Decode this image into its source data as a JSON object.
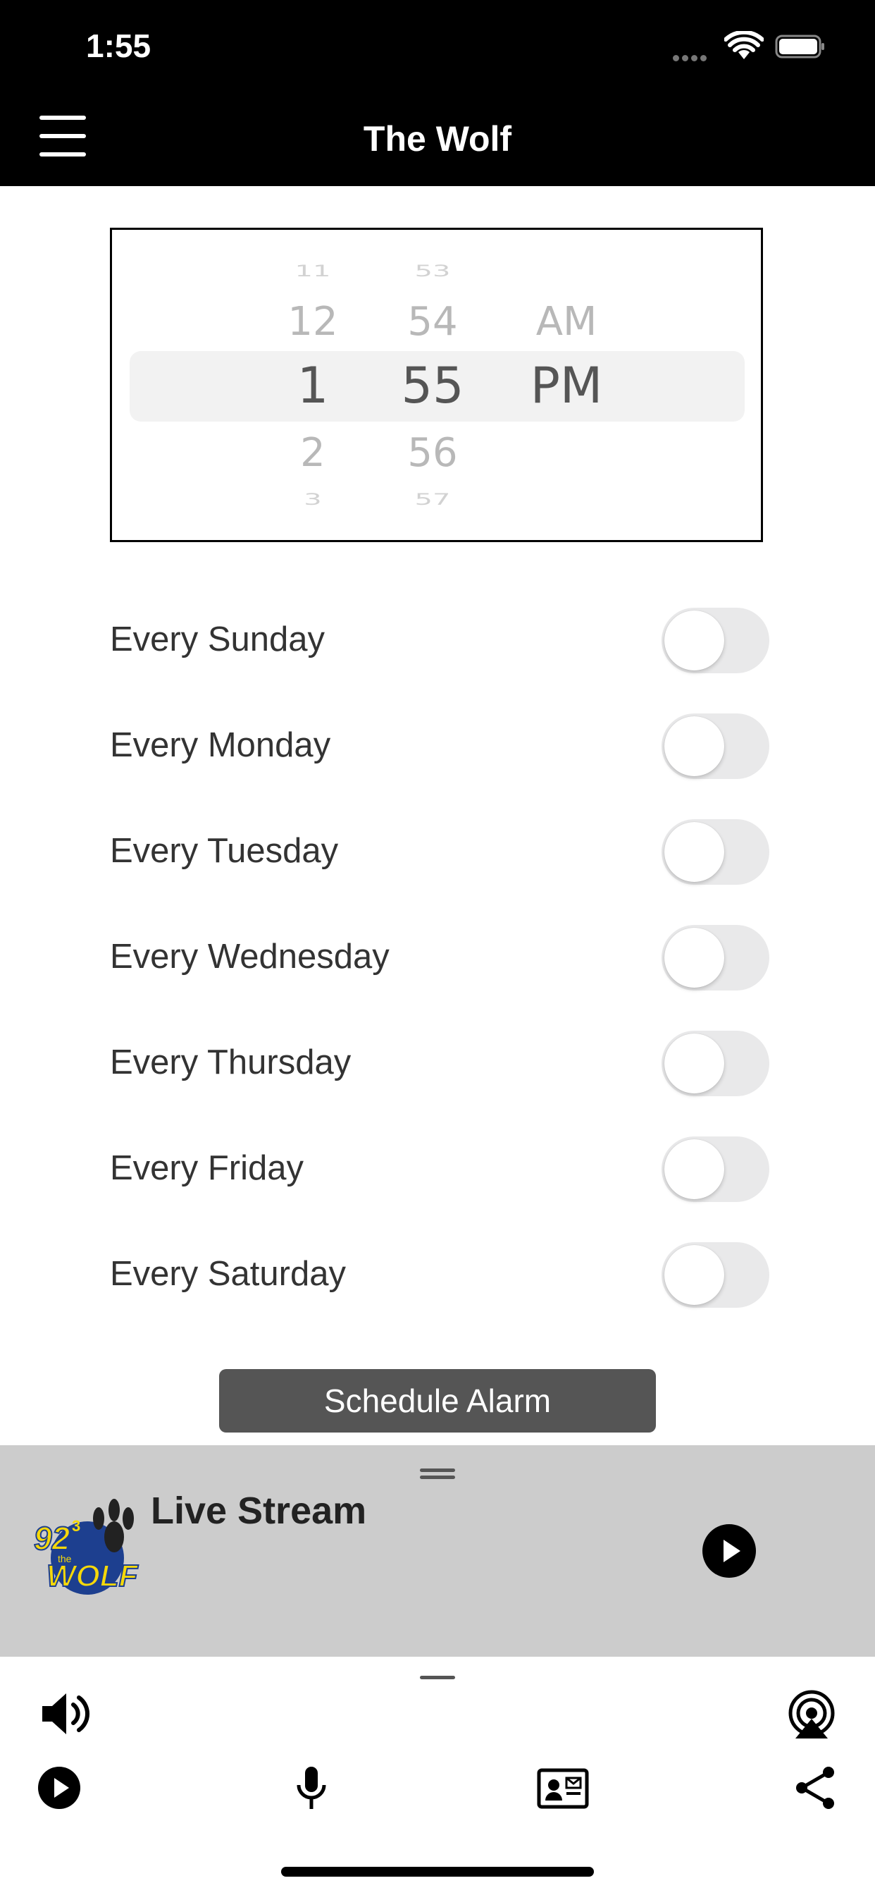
{
  "status_bar": {
    "time": "1:55"
  },
  "nav": {
    "title": "The Wolf",
    "menu_icon": "hamburger-menu-icon"
  },
  "picker": {
    "hours": [
      "11",
      "12",
      "1",
      "2",
      "3"
    ],
    "minutes": [
      "53",
      "54",
      "55",
      "56",
      "57"
    ],
    "periods": [
      "AM",
      "PM"
    ],
    "selected": {
      "hour": "1",
      "minute": "55",
      "period": "PM"
    }
  },
  "days": [
    {
      "label": "Every Sunday",
      "on": false
    },
    {
      "label": "Every Monday",
      "on": false
    },
    {
      "label": "Every Tuesday",
      "on": false
    },
    {
      "label": "Every Wednesday",
      "on": false
    },
    {
      "label": "Every Thursday",
      "on": false
    },
    {
      "label": "Every Friday",
      "on": false
    },
    {
      "label": "Every Saturday",
      "on": false
    }
  ],
  "schedule_button": "Schedule Alarm",
  "player": {
    "title": "Live Stream",
    "logo_text": {
      "number": "92",
      "sup": "3",
      "the": "the",
      "name": "WOLF"
    }
  },
  "colors": {
    "nav_bg": "#000000",
    "player_bg": "#cccccc",
    "button_bg": "#555555",
    "toggle_off": "#e9e9ea"
  },
  "icons": [
    "volume-icon",
    "airplay-icon",
    "play-icon",
    "microphone-icon",
    "contact-card-icon",
    "share-icon"
  ]
}
